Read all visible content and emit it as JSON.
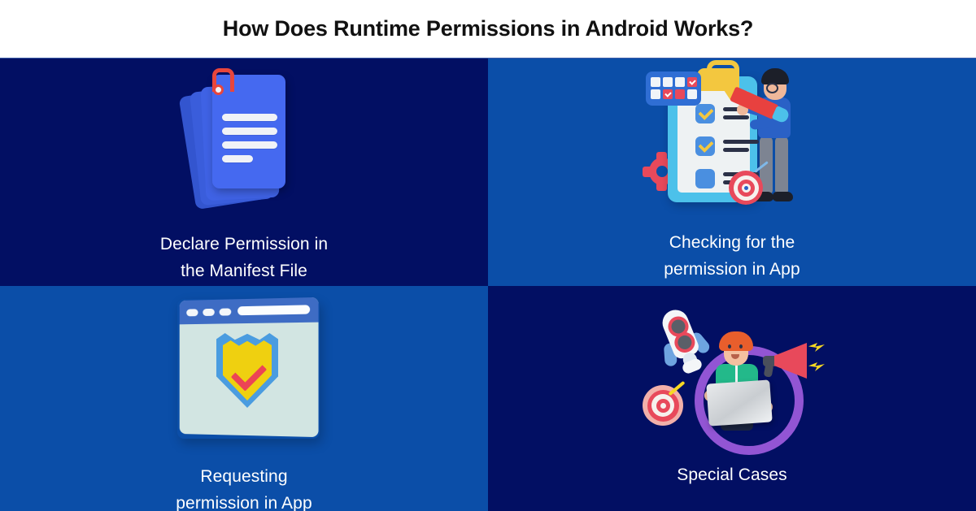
{
  "header": {
    "title": "How Does Runtime Permissions in Android Works?"
  },
  "colors": {
    "navy": "#020f63",
    "blue": "#0b4ea8",
    "page_background": "#ffffff",
    "title_text": "#111111",
    "caption_text": "#ffffff",
    "accent_red": "#e8495b",
    "accent_yellow": "#f3c73f",
    "accent_purple": "#9255d4",
    "accent_green": "#23b98a",
    "accent_cyan": "#4cc1ea"
  },
  "cells": [
    {
      "id": "declare-permission",
      "caption_line1": "Declare Permission in",
      "caption_line2": "the Manifest File",
      "background": "navy",
      "icon": "stacked-documents-icon"
    },
    {
      "id": "checking-permission",
      "caption_line1": "Checking for the",
      "caption_line2": "permission in App",
      "background": "blue",
      "icon": "clipboard-checklist-person-icon"
    },
    {
      "id": "requesting-permission",
      "caption_line1": "Requesting",
      "caption_line2": "permission in App",
      "background": "blue",
      "icon": "browser-shield-check-icon"
    },
    {
      "id": "special-cases",
      "caption_line1": "Special Cases",
      "caption_line2": "",
      "background": "navy",
      "icon": "rocket-laptop-megaphone-icon"
    }
  ]
}
